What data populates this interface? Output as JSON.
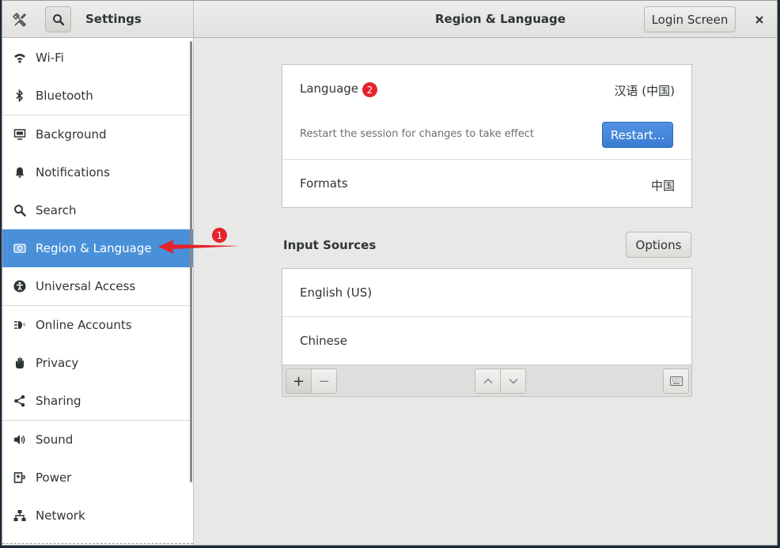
{
  "header": {
    "sidebar_title": "Settings",
    "panel_title": "Region & Language",
    "login_screen_label": "Login Screen"
  },
  "sidebar": {
    "items": [
      {
        "label": "Wi-Fi",
        "icon": "wifi-icon"
      },
      {
        "label": "Bluetooth",
        "icon": "bluetooth-icon"
      },
      {
        "label": "Background",
        "icon": "background-icon"
      },
      {
        "label": "Notifications",
        "icon": "bell-icon"
      },
      {
        "label": "Search",
        "icon": "search-icon"
      },
      {
        "label": "Region & Language",
        "icon": "region-icon",
        "selected": true
      },
      {
        "label": "Universal Access",
        "icon": "accessibility-icon"
      },
      {
        "label": "Online Accounts",
        "icon": "online-accounts-icon"
      },
      {
        "label": "Privacy",
        "icon": "privacy-hand-icon"
      },
      {
        "label": "Sharing",
        "icon": "share-icon"
      },
      {
        "label": "Sound",
        "icon": "speaker-icon"
      },
      {
        "label": "Power",
        "icon": "power-icon"
      },
      {
        "label": "Network",
        "icon": "network-icon"
      }
    ]
  },
  "language": {
    "label": "Language",
    "value": "汉语 (中国)",
    "restart_hint": "Restart the session for changes to take effect",
    "restart_label": "Restart...",
    "formats_label": "Formats",
    "formats_value": "中国"
  },
  "input_sources": {
    "title": "Input Sources",
    "options_label": "Options",
    "items": [
      "English (US)",
      "Chinese"
    ],
    "add_label": "+",
    "remove_label": "−"
  },
  "annotations": {
    "badge1": "1",
    "badge2": "2"
  },
  "colors": {
    "accent": "#4a90d9",
    "annotation": "#e5232b"
  }
}
